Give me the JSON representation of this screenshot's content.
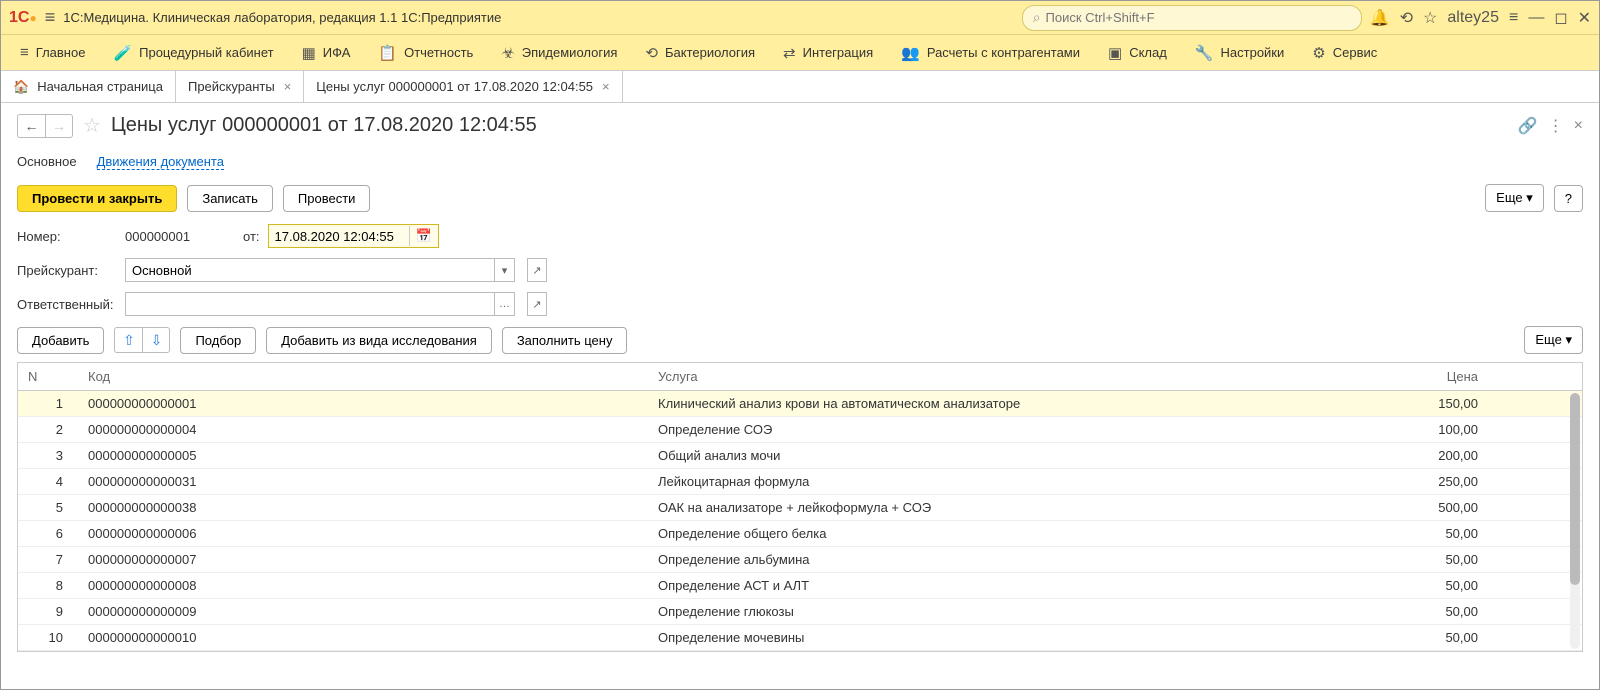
{
  "titlebar": {
    "app_title": "1С:Медицина. Клиническая лаборатория, редакция 1.1 1С:Предприятие",
    "search_placeholder": "Поиск Ctrl+Shift+F",
    "user": "altey25"
  },
  "nav": {
    "items": [
      {
        "icon": "≡",
        "label": "Главное"
      },
      {
        "icon": "🧪",
        "label": "Процедурный кабинет"
      },
      {
        "icon": "▦",
        "label": "ИФА"
      },
      {
        "icon": "📋",
        "label": "Отчетность"
      },
      {
        "icon": "☣",
        "label": "Эпидемиология"
      },
      {
        "icon": "⟲",
        "label": "Бактериология"
      },
      {
        "icon": "⇄",
        "label": "Интеграция"
      },
      {
        "icon": "👥",
        "label": "Расчеты с контрагентами"
      },
      {
        "icon": "▣",
        "label": "Склад"
      },
      {
        "icon": "🔧",
        "label": "Настройки"
      },
      {
        "icon": "⚙",
        "label": "Сервис"
      }
    ]
  },
  "tabs": {
    "home_label": "Начальная страница",
    "items": [
      {
        "label": "Прейскуранты"
      },
      {
        "label": "Цены услуг 000000001 от 17.08.2020 12:04:55"
      }
    ]
  },
  "page": {
    "title": "Цены услуг 000000001 от 17.08.2020 12:04:55"
  },
  "subtabs": {
    "main": "Основное",
    "movements": "Движения документа"
  },
  "actions": {
    "post_close": "Провести и закрыть",
    "write": "Записать",
    "post": "Провести",
    "more": "Еще",
    "help": "?"
  },
  "form": {
    "number_label": "Номер:",
    "number_value": "000000001",
    "date_label": "от:",
    "date_value": "17.08.2020 12:04:55",
    "pricelist_label": "Прейскурант:",
    "pricelist_value": "Основной",
    "responsible_label": "Ответственный:",
    "responsible_value": ""
  },
  "table_toolbar": {
    "add": "Добавить",
    "pick": "Подбор",
    "add_from_research": "Добавить из вида исследования",
    "fill_price": "Заполнить цену",
    "more": "Еще"
  },
  "table": {
    "headers": {
      "n": "N",
      "code": "Код",
      "service": "Услуга",
      "price": "Цена"
    },
    "rows": [
      {
        "n": "1",
        "code": "000000000000001",
        "service": "Клинический анализ крови на автоматическом анализаторе",
        "price": "150,00"
      },
      {
        "n": "2",
        "code": "000000000000004",
        "service": "Определение СОЭ",
        "price": "100,00"
      },
      {
        "n": "3",
        "code": "000000000000005",
        "service": "Общий анализ мочи",
        "price": "200,00"
      },
      {
        "n": "4",
        "code": "000000000000031",
        "service": "Лейкоцитарная формула",
        "price": "250,00"
      },
      {
        "n": "5",
        "code": "000000000000038",
        "service": "ОАК на анализаторе + лейкоформула + СОЭ",
        "price": "500,00"
      },
      {
        "n": "6",
        "code": "000000000000006",
        "service": "Определение общего белка",
        "price": "50,00"
      },
      {
        "n": "7",
        "code": "000000000000007",
        "service": "Определение альбумина",
        "price": "50,00"
      },
      {
        "n": "8",
        "code": "000000000000008",
        "service": "Определение АСТ и АЛТ",
        "price": "50,00"
      },
      {
        "n": "9",
        "code": "000000000000009",
        "service": "Определение глюкозы",
        "price": "50,00"
      },
      {
        "n": "10",
        "code": "000000000000010",
        "service": "Определение мочевины",
        "price": "50,00"
      }
    ]
  }
}
